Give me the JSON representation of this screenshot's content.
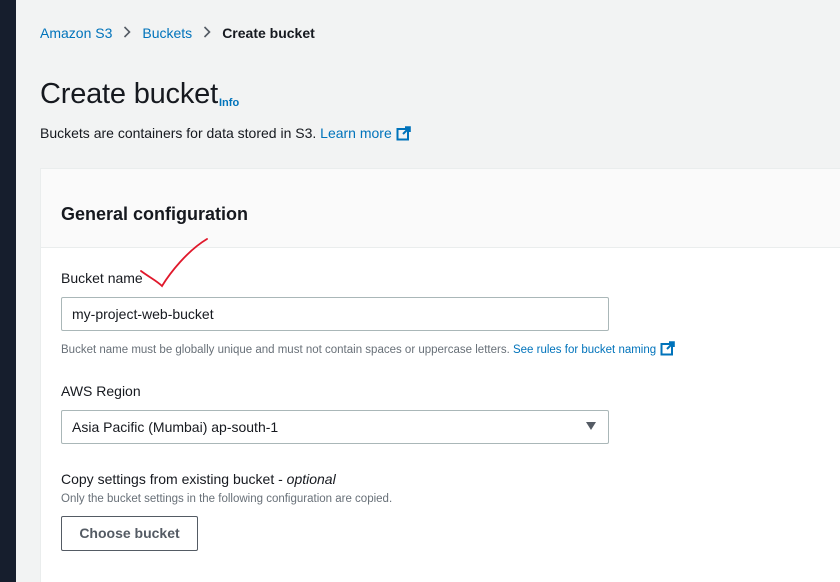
{
  "breadcrumb": {
    "items": [
      "Amazon S3",
      "Buckets"
    ],
    "current": "Create bucket"
  },
  "page": {
    "title": "Create bucket",
    "info_link": "Info",
    "description": "Buckets are containers for data stored in S3.",
    "learn_more": "Learn more"
  },
  "general_configuration": {
    "title": "General configuration",
    "bucket_name": {
      "label": "Bucket name",
      "value": "my-project-web-bucket",
      "hint": "Bucket name must be globally unique and must not contain spaces or uppercase letters.",
      "hint_link": "See rules for bucket naming"
    },
    "region": {
      "label": "AWS Region",
      "value": "Asia Pacific (Mumbai) ap-south-1"
    },
    "copy_settings": {
      "label": "Copy settings from existing bucket - ",
      "label_optional": "optional",
      "hint": "Only the bucket settings in the following configuration are copied.",
      "button": "Choose bucket"
    }
  },
  "colors": {
    "link": "#0073bb",
    "annotation": "#e0182b",
    "background": "#f2f3f3",
    "frame": "#161e2d"
  },
  "icons": [
    "chevron-right-icon",
    "external-link-icon",
    "caret-down-icon",
    "checkmark-annotation"
  ]
}
